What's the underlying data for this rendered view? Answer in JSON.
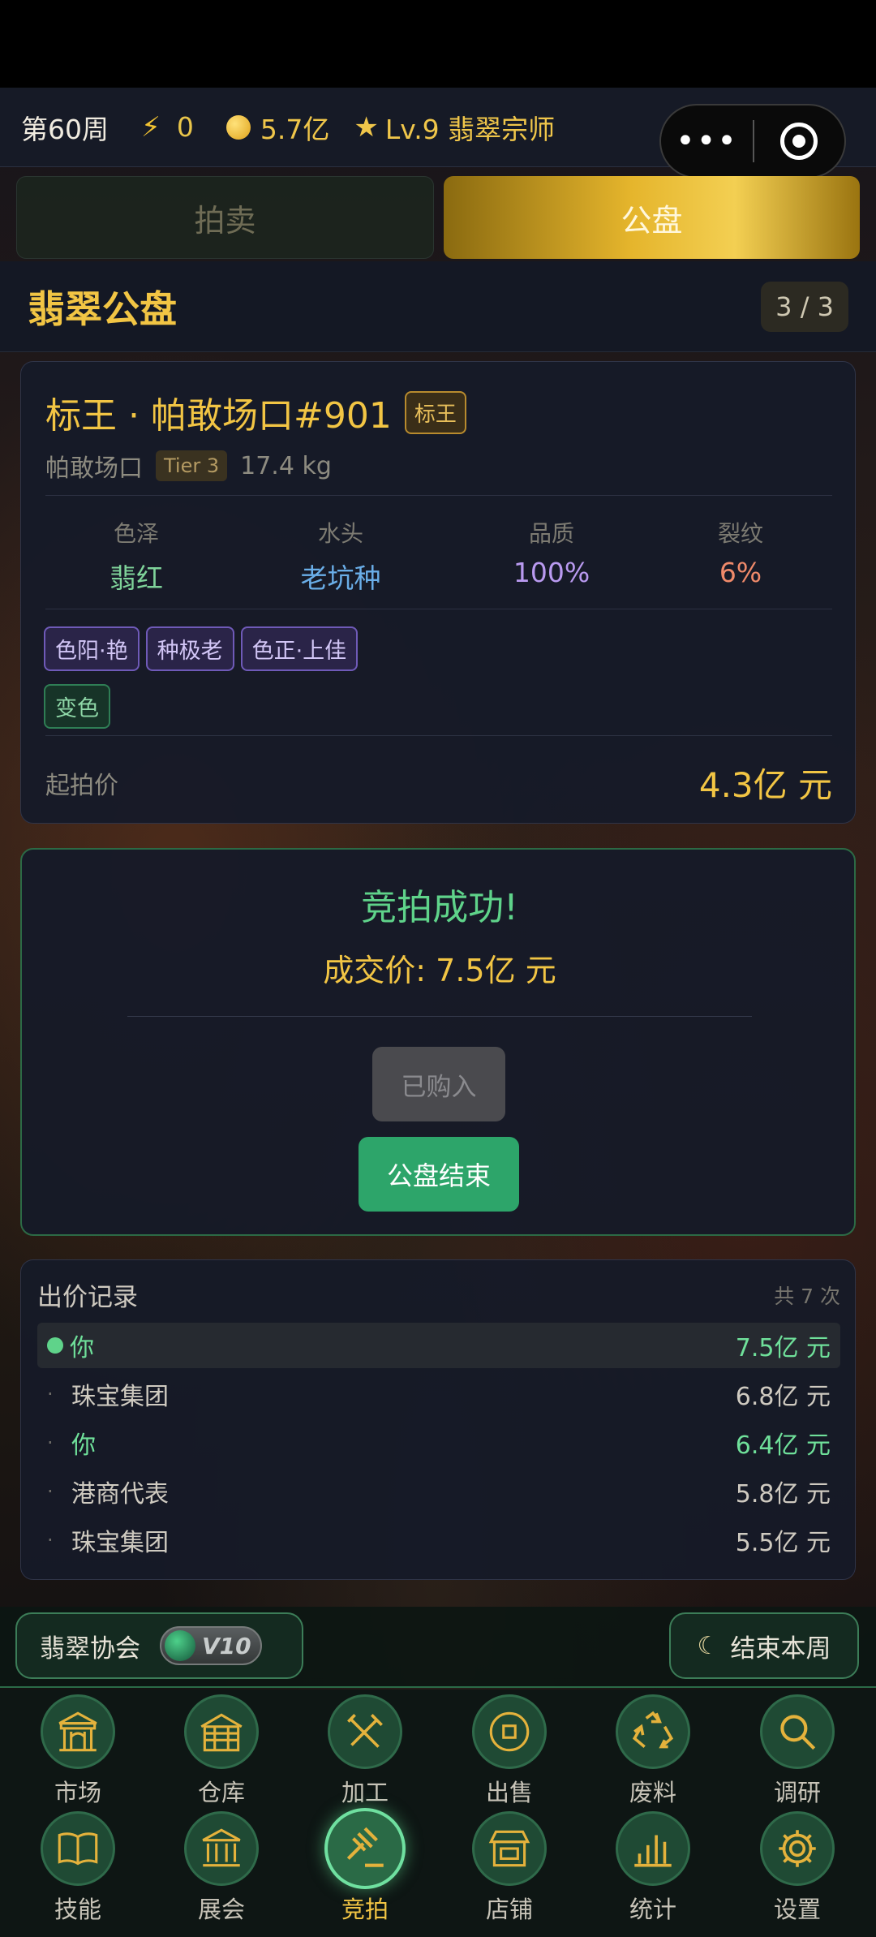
{
  "header": {
    "week": "第60周",
    "energy": "0",
    "money": "5.7亿",
    "level": "Lv.9 翡翠宗师"
  },
  "tabs": [
    {
      "label": "拍卖",
      "active": false
    },
    {
      "label": "公盘",
      "active": true
    }
  ],
  "section": {
    "title": "翡翠公盘",
    "page": "3 / 3"
  },
  "item": {
    "name": "标王 · 帕敢场口#901",
    "badge": "标王",
    "origin": "帕敢场口",
    "tier": "Tier 3",
    "weight": "17.4 kg",
    "stats": [
      {
        "label": "色泽",
        "value": "翡红",
        "color": "#7fd39a"
      },
      {
        "label": "水头",
        "value": "老坑种",
        "color": "#6aaee8"
      },
      {
        "label": "品质",
        "value": "100%",
        "color": "#b99af0"
      },
      {
        "label": "裂纹",
        "value": "6%",
        "color": "#f08a6a"
      }
    ],
    "tags_purple": [
      "色阳·艳",
      "种极老",
      "色正·上佳"
    ],
    "tags_green": [
      "变色"
    ],
    "start_price_label": "起拍价",
    "start_price": "4.3亿 元"
  },
  "result": {
    "title": "竞拍成功!",
    "deal_price": "成交价: 7.5亿 元",
    "bought_label": "已购入",
    "end_label": "公盘结束"
  },
  "bids": {
    "title": "出价记录",
    "count": "共 7 次",
    "rows": [
      {
        "who": "你",
        "amount": "7.5亿 元",
        "me": true
      },
      {
        "who": "珠宝集团",
        "amount": "6.8亿 元",
        "me": false
      },
      {
        "who": "你",
        "amount": "6.4亿 元",
        "me": true
      },
      {
        "who": "港商代表",
        "amount": "5.8亿 元",
        "me": false
      },
      {
        "who": "珠宝集团",
        "amount": "5.5亿 元",
        "me": false
      }
    ]
  },
  "actions": {
    "association": "翡翠协会",
    "vip": "V10",
    "end_week": "结束本周"
  },
  "nav": [
    {
      "label": "市场",
      "icon": "gate-icon"
    },
    {
      "label": "仓库",
      "icon": "warehouse-icon"
    },
    {
      "label": "加工",
      "icon": "tools-icon"
    },
    {
      "label": "出售",
      "icon": "coin-icon"
    },
    {
      "label": "废料",
      "icon": "recycle-icon"
    },
    {
      "label": "调研",
      "icon": "magnifier-icon"
    },
    {
      "label": "技能",
      "icon": "book-icon"
    },
    {
      "label": "展会",
      "icon": "museum-icon"
    },
    {
      "label": "竞拍",
      "icon": "gavel-icon",
      "active": true
    },
    {
      "label": "店铺",
      "icon": "shop-icon"
    },
    {
      "label": "统计",
      "icon": "bar-chart-icon"
    },
    {
      "label": "设置",
      "icon": "gear-icon"
    }
  ],
  "colors": {
    "accent_gold": "#f2c544",
    "success_green": "#5fd38a",
    "button_green": "#2da56a"
  }
}
